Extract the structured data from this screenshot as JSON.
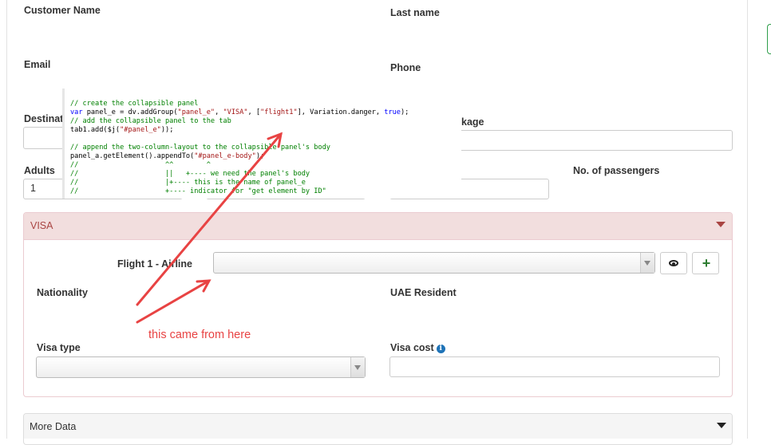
{
  "form": {
    "customer_name_label": "Customer Name",
    "last_name_label": "Last name",
    "email_label": "Email",
    "phone_label": "Phone",
    "destination_label": "Destinati",
    "package_label": "kage",
    "adults_label": "Adults",
    "adults_value": "1",
    "passengers_label": "No. of passengers"
  },
  "visa_panel": {
    "title": "VISA",
    "flight_label": "Flight 1 - Airline",
    "flight_value": "",
    "nationality_label": "Nationality",
    "uae_resident_label": "UAE Resident",
    "visa_type_label": "Visa type",
    "visa_type_value": "",
    "visa_cost_label": "Visa cost",
    "visa_cost_value": ""
  },
  "more_panel": {
    "title": "More Data"
  },
  "code_snippet": {
    "line1": "// create the collapsible panel",
    "line2_a": "var",
    "line2_b": " panel_e = dv.addGroup(",
    "line2_c": "\"panel_e\"",
    "line2_d": ", ",
    "line2_e": "\"VISA\"",
    "line2_f": ", [",
    "line2_g": "\"flight1\"",
    "line2_h": "], Variation.danger, ",
    "line2_i": "true",
    "line2_j": ");",
    "line3": "// add the collapsible panel to the tab",
    "line4_a": "tab1.add($j(",
    "line4_b": "\"#panel_e\"",
    "line4_c": "));",
    "line5": "// append the two-column-layout to the collapsible panel's body",
    "line6_a": "panel_a.getElement().appendTo(",
    "line6_b": "\"#panel_e-body\"",
    "line6_c": ");",
    "line7": "//                     ^^        ^",
    "line8": "//                     ||   +---- we need the panel's body",
    "line9": "//                     |+---- this is the name of panel_e",
    "line10": "//                     +---- indicator for \"get element by ID\""
  },
  "annotation": {
    "text": "this came from here",
    "color": "#e84343"
  },
  "colors": {
    "danger_bg": "#f2dede",
    "danger_text": "#a94442",
    "add_green": "#2e7d32",
    "info_blue": "#1f73b7"
  },
  "icons": [
    "eye-icon",
    "plus-icon",
    "info-icon",
    "chevron-down-icon"
  ]
}
